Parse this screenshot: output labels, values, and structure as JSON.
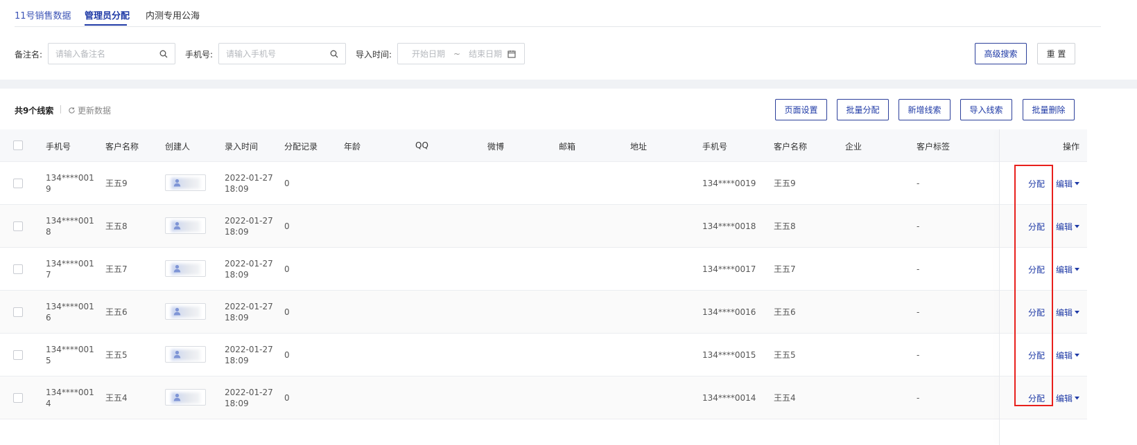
{
  "tabs": [
    {
      "label": "11号销售数据"
    },
    {
      "label": "管理员分配"
    },
    {
      "label": "内测专用公海"
    }
  ],
  "filters": {
    "note_label": "备注名:",
    "note_placeholder": "请输入备注名",
    "phone_label": "手机号:",
    "phone_placeholder": "请输入手机号",
    "import_time_label": "导入时间:",
    "start_date": "开始日期",
    "tilde": "~",
    "end_date": "结束日期",
    "advanced_search": "高级搜索",
    "reset": "重 置"
  },
  "toolbar": {
    "total": "共9个线索",
    "refresh": "更新数据",
    "page_settings": "页面设置",
    "batch_assign": "批量分配",
    "add_lead": "新增线索",
    "import_lead": "导入线索",
    "batch_delete": "批量删除"
  },
  "columns": [
    "手机号",
    "客户名称",
    "创建人",
    "录入时间",
    "分配记录",
    "年龄",
    "QQ",
    "微博",
    "邮箱",
    "地址",
    "手机号",
    "客户名称",
    "企业",
    "客户标签",
    "操作"
  ],
  "rows": [
    {
      "phone_a": "134****001",
      "phone_b": "9",
      "name": "王五9",
      "date": "2022-01-27",
      "time": "18:09",
      "assign": "0",
      "phone2": "134****0019",
      "name2": "王五9",
      "tag": "-"
    },
    {
      "phone_a": "134****001",
      "phone_b": "8",
      "name": "王五8",
      "date": "2022-01-27",
      "time": "18:09",
      "assign": "0",
      "phone2": "134****0018",
      "name2": "王五8",
      "tag": "-"
    },
    {
      "phone_a": "134****001",
      "phone_b": "7",
      "name": "王五7",
      "date": "2022-01-27",
      "time": "18:09",
      "assign": "0",
      "phone2": "134****0017",
      "name2": "王五7",
      "tag": "-"
    },
    {
      "phone_a": "134****001",
      "phone_b": "6",
      "name": "王五6",
      "date": "2022-01-27",
      "time": "18:09",
      "assign": "0",
      "phone2": "134****0016",
      "name2": "王五6",
      "tag": "-"
    },
    {
      "phone_a": "134****001",
      "phone_b": "5",
      "name": "王五5",
      "date": "2022-01-27",
      "time": "18:09",
      "assign": "0",
      "phone2": "134****0015",
      "name2": "王五5",
      "tag": "-"
    },
    {
      "phone_a": "134****001",
      "phone_b": "4",
      "name": "王五4",
      "date": "2022-01-27",
      "time": "18:09",
      "assign": "0",
      "phone2": "134****0014",
      "name2": "王五4",
      "tag": "-"
    }
  ],
  "actions": {
    "assign": "分配",
    "edit": "编辑"
  },
  "colors": {
    "accent": "#1f3aa6",
    "highlight": "#e8201c"
  }
}
